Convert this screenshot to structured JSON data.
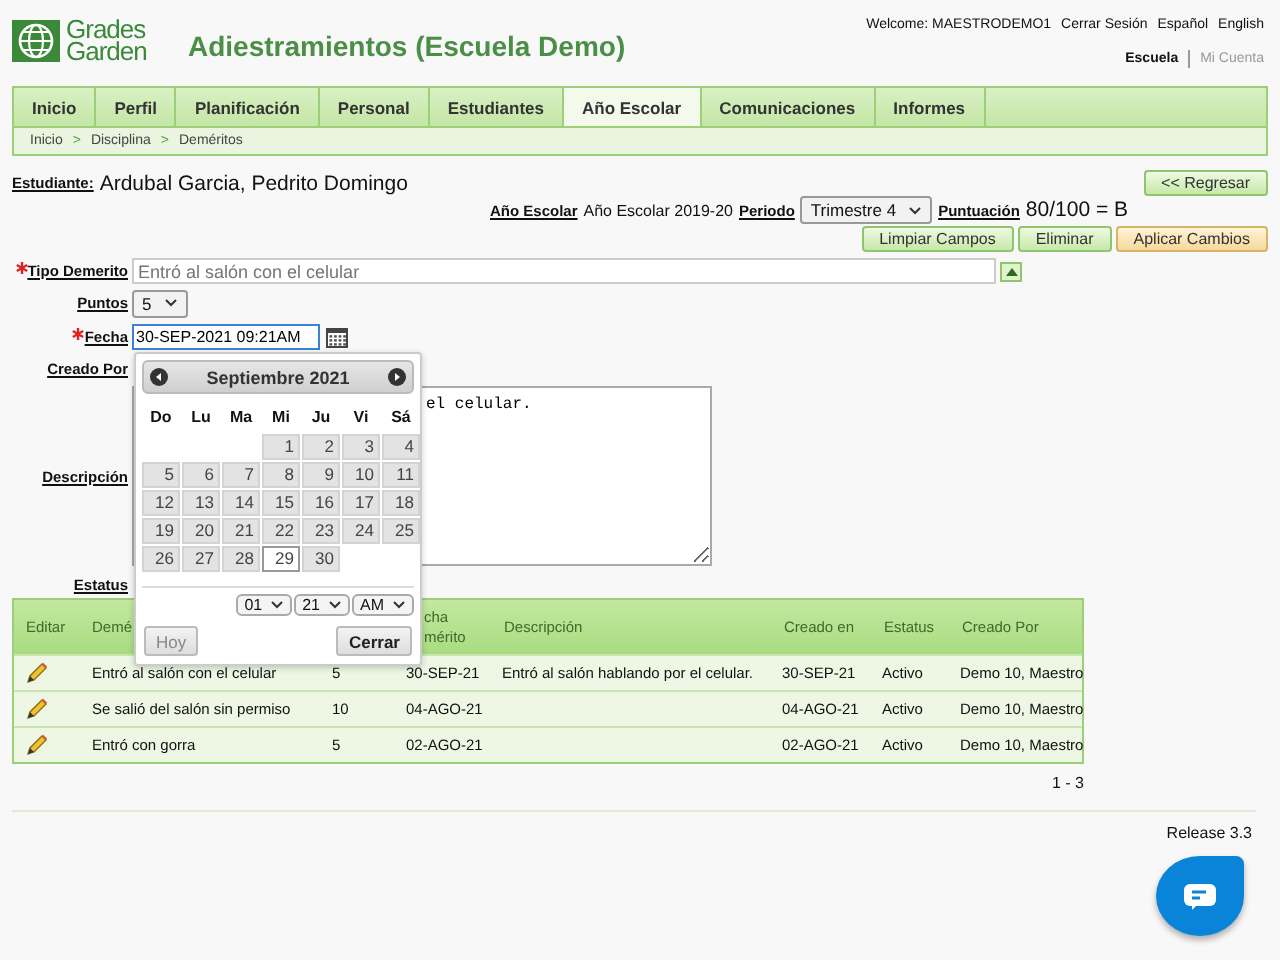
{
  "header": {
    "logo_line1": "Grades",
    "logo_line2": "Garden",
    "title": "Adiestramientos (Escuela Demo)",
    "welcome": "Welcome: MAESTRODEMO1",
    "links": [
      "Cerrar Sesión",
      "Español",
      "English"
    ],
    "account_tabs": [
      {
        "label": "Escuela",
        "selected": true
      },
      {
        "label": "Mi Cuenta",
        "selected": false
      }
    ]
  },
  "nav": {
    "tabs": [
      {
        "label": "Inicio",
        "selected": false
      },
      {
        "label": "Perfil",
        "selected": false
      },
      {
        "label": "Planificación",
        "selected": false
      },
      {
        "label": "Personal",
        "selected": false
      },
      {
        "label": "Estudiantes",
        "selected": false
      },
      {
        "label": "Año Escolar",
        "selected": true
      },
      {
        "label": "Comunicaciones",
        "selected": false
      },
      {
        "label": "Informes",
        "selected": false
      }
    ],
    "breadcrumb": [
      "Inicio",
      "Disciplina",
      "Deméritos"
    ],
    "separator": ">"
  },
  "student": {
    "label": "Estudiante:",
    "name": "Ardubal Garcia, Pedrito Domingo",
    "back_button": "<< Regresar"
  },
  "term": {
    "year_label": "Año Escolar",
    "year": "Año Escolar 2019-20",
    "period_label": "Periodo",
    "period": "Trimestre 4",
    "score_label": "Puntuación",
    "score": "80/100 = B"
  },
  "actions": [
    {
      "label": "Limpiar Campos",
      "kind": "normal"
    },
    {
      "label": "Eliminar",
      "kind": "normal"
    },
    {
      "label": "Aplicar Cambios",
      "kind": "apply"
    }
  ],
  "form": [
    {
      "label": "Tipo Demerito",
      "required": true,
      "kind": "lookup",
      "placeholder": "Entró al salón con el celular"
    },
    {
      "label": "Puntos",
      "required": false,
      "kind": "select",
      "value": "5"
    },
    {
      "label": "Fecha",
      "required": true,
      "kind": "date",
      "value": "30-SEP-2021 09:21AM"
    },
    {
      "label": "Creado Por",
      "required": false,
      "kind": "hidden"
    },
    {
      "label": "Descripción",
      "required": false,
      "kind": "textarea",
      "value": "el celular."
    },
    {
      "label": "Estatus",
      "required": false,
      "kind": "hidden"
    }
  ],
  "calendar": {
    "title": "Septiembre 2021",
    "weekdays": [
      "Do",
      "Lu",
      "Ma",
      "Mi",
      "Ju",
      "Vi",
      "Sá"
    ],
    "weeks": [
      [
        {
          "label": "1",
          "selected": false
        },
        {
          "label": "2",
          "selected": false
        },
        {
          "label": "3",
          "selected": false
        },
        {
          "label": "4",
          "selected": false
        }
      ],
      [
        {
          "label": "5",
          "selected": false
        },
        {
          "label": "6",
          "selected": false
        },
        {
          "label": "7",
          "selected": false
        },
        {
          "label": "8",
          "selected": false
        },
        {
          "label": "9",
          "selected": false
        },
        {
          "label": "10",
          "selected": false
        },
        {
          "label": "11",
          "selected": false
        }
      ],
      [
        {
          "label": "12",
          "selected": false
        },
        {
          "label": "13",
          "selected": false
        },
        {
          "label": "14",
          "selected": false
        },
        {
          "label": "15",
          "selected": false
        },
        {
          "label": "16",
          "selected": false
        },
        {
          "label": "17",
          "selected": false
        },
        {
          "label": "18",
          "selected": false
        }
      ],
      [
        {
          "label": "19",
          "selected": false
        },
        {
          "label": "20",
          "selected": false
        },
        {
          "label": "21",
          "selected": false
        },
        {
          "label": "22",
          "selected": false
        },
        {
          "label": "23",
          "selected": false
        },
        {
          "label": "24",
          "selected": false
        },
        {
          "label": "25",
          "selected": false
        }
      ],
      [
        {
          "label": "26",
          "selected": false
        },
        {
          "label": "27",
          "selected": false
        },
        {
          "label": "28",
          "selected": false
        },
        {
          "label": "29",
          "selected": true
        },
        {
          "label": "30",
          "selected": false
        }
      ]
    ],
    "time": [
      "01",
      "21",
      "AM"
    ],
    "today_button": {
      "label": "Hoy",
      "disabled": true
    },
    "close_button": "Cerrar"
  },
  "table": {
    "columns": [
      "Editar",
      "Demé",
      null,
      "cha mérito",
      "Descripción",
      "Creado en",
      "Estatus",
      "Creado Por"
    ],
    "rows": [
      [
        "",
        "Entró al salón con el celular",
        "5",
        "30-SEP-21",
        "Entró al salón hablando por el celular.",
        "30-SEP-21",
        "Activo",
        "Demo 10, Maestro"
      ],
      [
        "",
        "Se salió del salón sin permiso",
        "10",
        "04-AGO-21",
        "",
        "04-AGO-21",
        "Activo",
        "Demo 10, Maestro"
      ],
      [
        "",
        "Entró con gorra",
        "5",
        "02-AGO-21",
        "",
        "02-AGO-21",
        "Activo",
        "Demo 10, Maestro"
      ]
    ],
    "pager": "1 - 3"
  },
  "footer": {
    "release": "Release 3.3"
  }
}
